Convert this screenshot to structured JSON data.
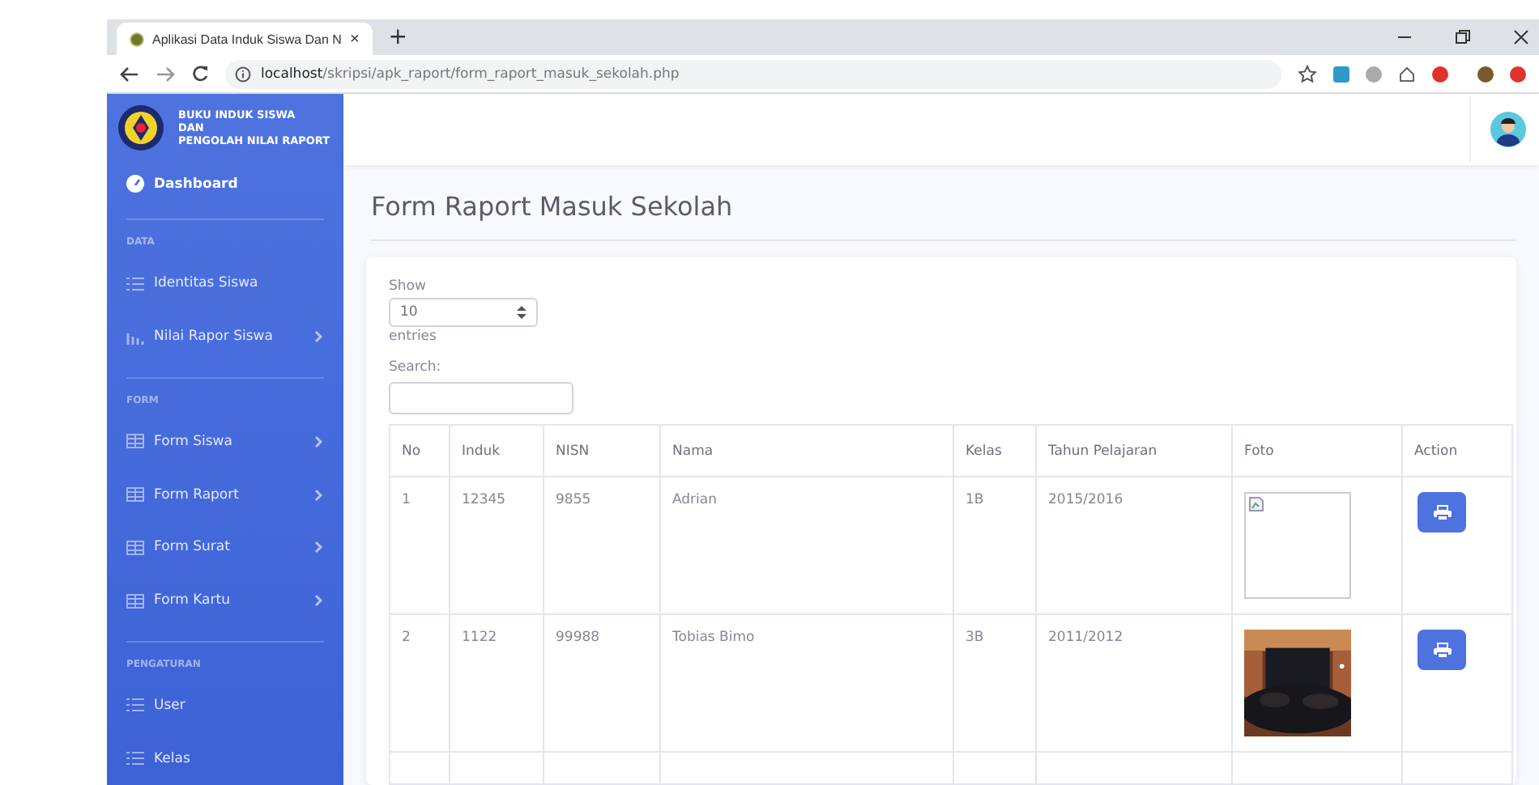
{
  "browser": {
    "tab_title": "Aplikasi Data Induk Siswa Dan N",
    "tab_close": "×",
    "new_tab": "+",
    "url": "**localhost**/skripsi/apk_raport/form_raport_masuk_sekolah.php"
  },
  "sidebar": {
    "brand": [
      "BUKU INDUK SISWA",
      "DAN",
      "PENGOLAH NILAI RAPORT"
    ],
    "items": [
      {
        "kind": "dashboard",
        "label": "Dashboard",
        "submenu": false
      },
      {
        "kind": "divider"
      },
      {
        "kind": "heading",
        "label": "DATA"
      },
      {
        "kind": "list",
        "label": "Identitas Siswa",
        "submenu": false
      },
      {
        "kind": "chart",
        "label": "Nilai Rapor Siswa",
        "submenu": true
      },
      {
        "kind": "divider"
      },
      {
        "kind": "heading",
        "label": "FORM"
      },
      {
        "kind": "grid",
        "label": "Form Siswa",
        "submenu": true
      },
      {
        "kind": "grid",
        "label": "Form Raport",
        "submenu": true
      },
      {
        "kind": "grid",
        "label": "Form Surat",
        "submenu": true
      },
      {
        "kind": "grid",
        "label": "Form Kartu",
        "submenu": true
      },
      {
        "kind": "divider"
      },
      {
        "kind": "heading",
        "label": "PENGATURAN"
      },
      {
        "kind": "list",
        "label": "User",
        "submenu": false
      },
      {
        "kind": "list",
        "label": "Kelas",
        "submenu": false
      }
    ]
  },
  "page_title": "Form Raport Masuk Sekolah",
  "length_menu": {
    "show": "Show",
    "value": "10",
    "entries": "entries"
  },
  "search": {
    "label": "Search:"
  },
  "table": {
    "columns": [
      "No",
      "Induk",
      "NISN",
      "Nama",
      "Kelas",
      "Tahun Pelajaran",
      "Foto",
      "Action"
    ],
    "rows": [
      {
        "cells": [
          "1",
          "12345",
          "9855",
          "Adrian",
          "1B",
          "2015/2016"
        ],
        "foto": {
          "kind": "broken"
        }
      },
      {
        "cells": [
          "2",
          "1122",
          "99988",
          "Tobias Bimo",
          "3B",
          "2011/2012"
        ]
      }
    ]
  }
}
